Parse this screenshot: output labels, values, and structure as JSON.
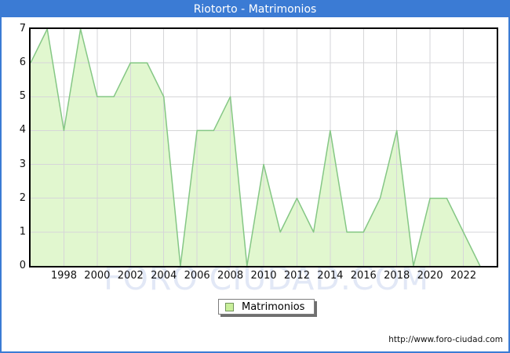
{
  "title": "Riotorto - Matrimonios",
  "legend": {
    "label": "Matrimonios"
  },
  "source_url": "http://www.foro-ciudad.com",
  "watermark": "FORO CIUDAD.COM",
  "colors": {
    "frame_blue": "#3b7bd4",
    "title_text": "#ffffff",
    "area_fill": "#e1f7cf",
    "area_line": "#85c785",
    "grid": "#d6d6d8",
    "plot_border": "#000000",
    "watermark_text": "#e2e8f6",
    "legend_swatch_fill": "#c9ef9b"
  },
  "chart_data": {
    "type": "area",
    "title": "Riotorto - Matrimonios",
    "series_name": "Matrimonios",
    "x": [
      1996,
      1997,
      1998,
      1999,
      2000,
      2001,
      2002,
      2003,
      2004,
      2005,
      2006,
      2007,
      2008,
      2009,
      2010,
      2011,
      2012,
      2013,
      2014,
      2015,
      2016,
      2017,
      2018,
      2019,
      2020,
      2021,
      2022,
      2023
    ],
    "values": [
      6,
      7,
      4,
      7,
      5,
      5,
      6,
      6,
      5,
      0,
      4,
      4,
      5,
      0,
      3,
      1,
      2,
      1,
      4,
      1,
      1,
      2,
      4,
      0,
      2,
      2,
      1,
      0
    ],
    "ylabel": "",
    "xlabel": "",
    "ylim": [
      0,
      7
    ],
    "x_domain": [
      1996,
      2024
    ],
    "y_ticks": [
      0,
      1,
      2,
      3,
      4,
      5,
      6,
      7
    ],
    "x_tick_years": [
      1998,
      2000,
      2002,
      2004,
      2006,
      2008,
      2010,
      2012,
      2014,
      2016,
      2018,
      2020,
      2022
    ],
    "grid": true,
    "legend_position": "bottom-center"
  }
}
